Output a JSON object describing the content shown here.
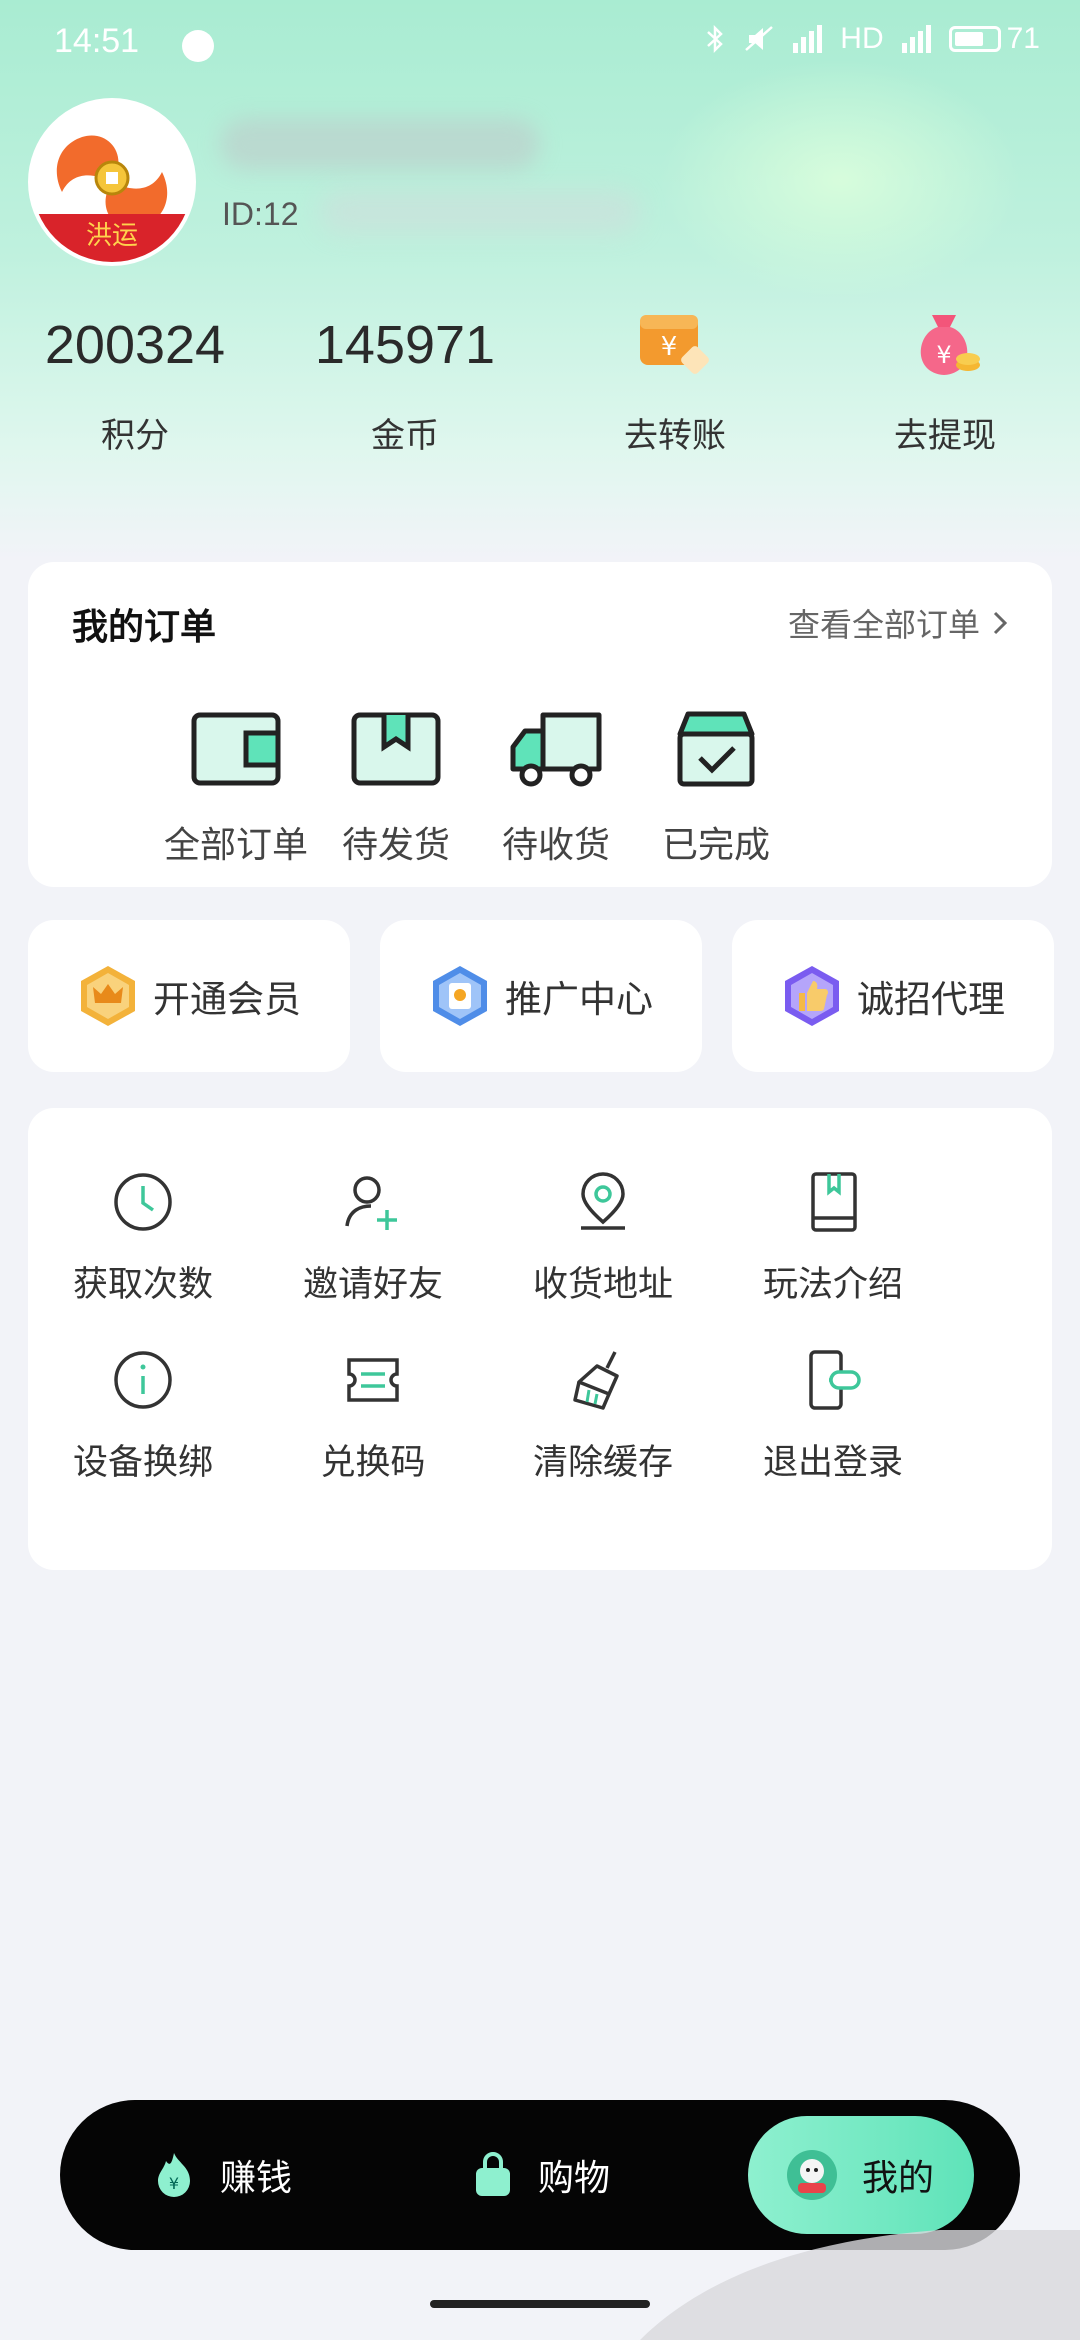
{
  "status_bar": {
    "time": "14:51",
    "network": "HD",
    "battery": "71"
  },
  "profile": {
    "id_text": "ID:12",
    "avatar_banner": "洪运"
  },
  "stats": [
    {
      "value": "200324",
      "label": "积分"
    },
    {
      "value": "145971",
      "label": "金币"
    },
    {
      "label": "去转账",
      "icon": "yuan-card-icon"
    },
    {
      "label": "去提现",
      "icon": "money-bag-icon"
    }
  ],
  "orders": {
    "title": "我的订单",
    "view_all": "查看全部订单",
    "items": [
      {
        "label": "全部订单",
        "icon": "wallet-icon"
      },
      {
        "label": "待发货",
        "icon": "package-icon"
      },
      {
        "label": "待收货",
        "icon": "truck-icon"
      },
      {
        "label": "已完成",
        "icon": "box-check-icon"
      }
    ]
  },
  "features": [
    {
      "label": "开通会员",
      "icon": "crown-badge-icon"
    },
    {
      "label": "推广中心",
      "icon": "promo-badge-icon"
    },
    {
      "label": "诚招代理",
      "icon": "thumbs-up-badge-icon"
    }
  ],
  "tools": [
    {
      "label": "获取次数",
      "icon": "clock-icon"
    },
    {
      "label": "邀请好友",
      "icon": "add-user-icon"
    },
    {
      "label": "收货地址",
      "icon": "location-pin-icon"
    },
    {
      "label": "玩法介绍",
      "icon": "book-icon"
    },
    {
      "label": "设备换绑",
      "icon": "info-icon"
    },
    {
      "label": "兑换码",
      "icon": "ticket-icon"
    },
    {
      "label": "清除缓存",
      "icon": "broom-icon"
    },
    {
      "label": "退出登录",
      "icon": "logout-icon"
    }
  ],
  "nav": [
    {
      "label": "赚钱",
      "icon": "flame-coin-icon"
    },
    {
      "label": "购物",
      "icon": "shopping-bag-icon"
    },
    {
      "label": "我的",
      "icon": "user-avatar-icon",
      "active": true
    }
  ],
  "colors": {
    "accent": "#5fe3b9",
    "accent_light": "#d9f7ec",
    "stroke": "#222222",
    "tool_stroke": "#333333"
  }
}
